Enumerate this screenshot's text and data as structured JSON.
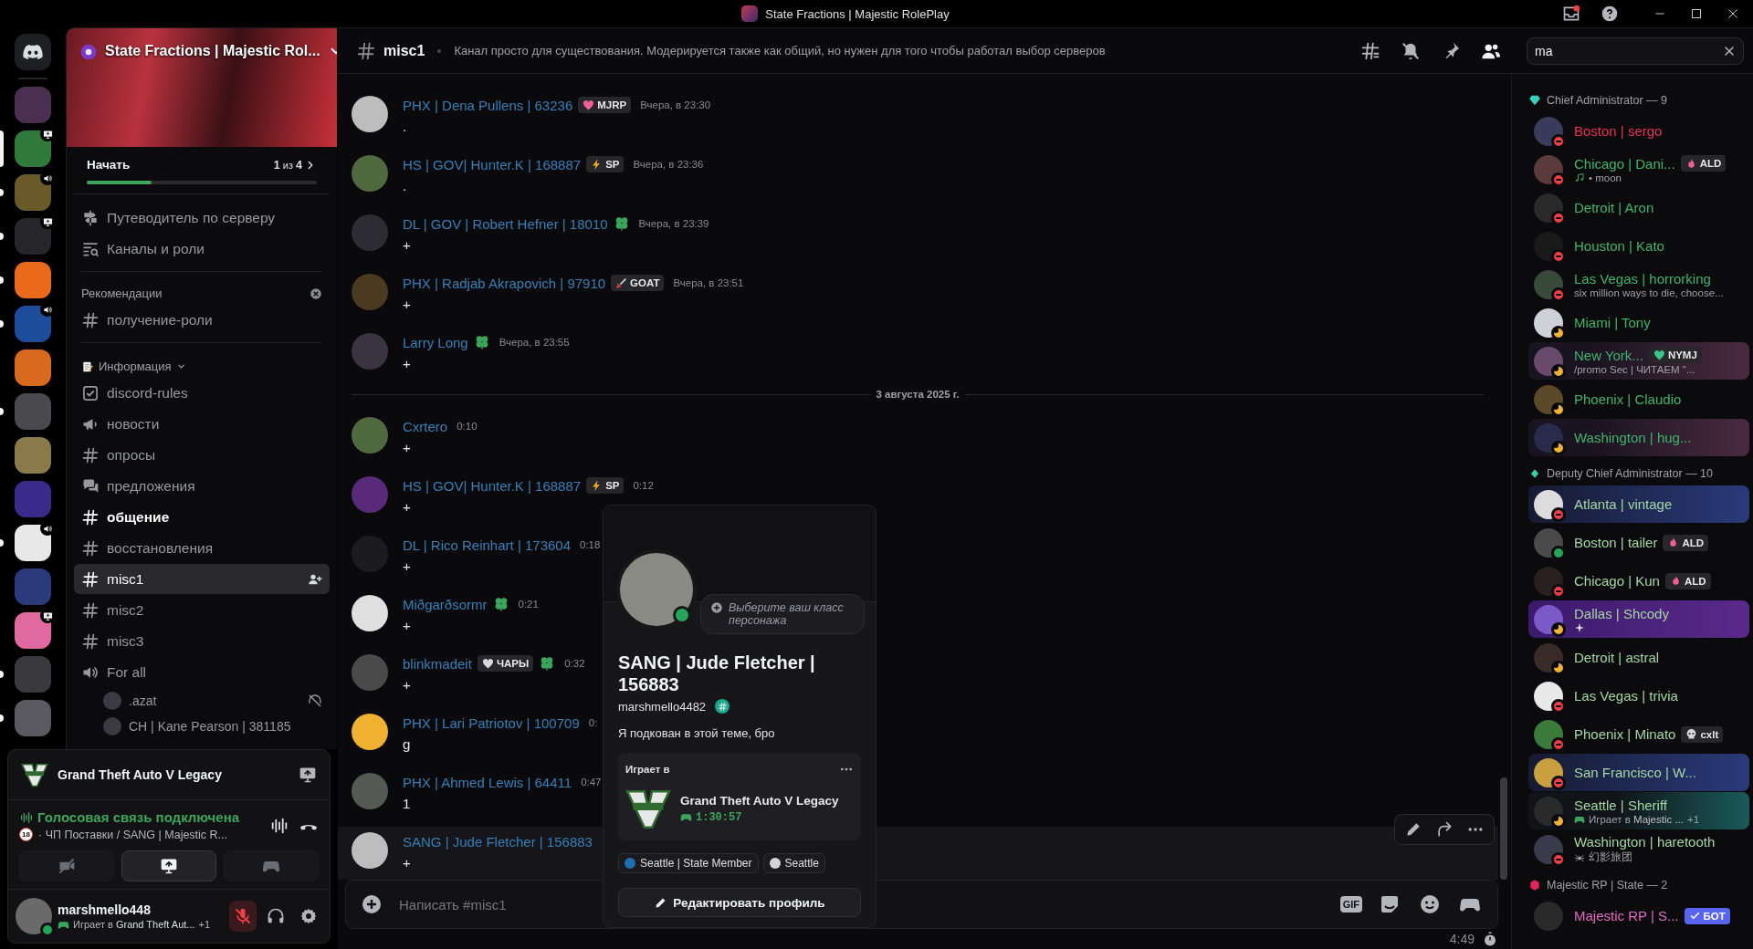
{
  "title_bar": {
    "title": "State Fractions | Majestic RolePlay"
  },
  "servers": [
    {
      "kind": "home",
      "selected": false,
      "unread": false,
      "voice": false,
      "streaming": false
    },
    {
      "kind": "server",
      "selected": false,
      "unread": false,
      "voice": false,
      "streaming": false
    },
    {
      "kind": "server",
      "selected": true,
      "unread": false,
      "voice": false,
      "streaming": true
    },
    {
      "kind": "server",
      "selected": false,
      "unread": true,
      "voice": true,
      "streaming": false
    },
    {
      "kind": "server",
      "selected": false,
      "unread": true,
      "voice": false,
      "streaming": true
    },
    {
      "kind": "server",
      "selected": false,
      "unread": true,
      "voice": false,
      "streaming": false
    },
    {
      "kind": "server",
      "selected": false,
      "unread": true,
      "voice": true,
      "streaming": false
    },
    {
      "kind": "server",
      "selected": false,
      "unread": false,
      "voice": false,
      "streaming": false
    },
    {
      "kind": "server",
      "selected": false,
      "unread": true,
      "voice": false,
      "streaming": false
    },
    {
      "kind": "server",
      "selected": false,
      "unread": false,
      "voice": false,
      "streaming": false
    },
    {
      "kind": "server",
      "selected": false,
      "unread": false,
      "voice": false,
      "streaming": false
    },
    {
      "kind": "server",
      "selected": false,
      "unread": true,
      "voice": true,
      "streaming": false
    },
    {
      "kind": "server",
      "selected": false,
      "unread": false,
      "voice": false,
      "streaming": false
    },
    {
      "kind": "server",
      "selected": false,
      "unread": false,
      "voice": false,
      "streaming": true
    },
    {
      "kind": "server",
      "selected": false,
      "unread": true,
      "voice": false,
      "streaming": false
    },
    {
      "kind": "server",
      "selected": false,
      "unread": true,
      "voice": false,
      "streaming": false
    }
  ],
  "channel_sidebar": {
    "server_name": "State Fractions | Majestic Rol...",
    "onboarding": {
      "label": "Начать",
      "progress": "**1** из **4**",
      "level": 0.28
    },
    "nav": [
      {
        "kind": "guide",
        "label": "Путеводитель по серверу"
      },
      {
        "kind": "browse",
        "label": "Каналы и роли"
      }
    ],
    "recommendations": {
      "title": "Рекомендации",
      "channels": [
        {
          "kind": "text",
          "name": "получение-роли"
        }
      ]
    },
    "category": {
      "name": "Информация",
      "expanded": true
    },
    "channels": [
      {
        "kind": "rules",
        "name": "discord-rules",
        "unread": false,
        "selected": false
      },
      {
        "kind": "announcement",
        "name": "новости",
        "unread": false,
        "selected": false
      },
      {
        "kind": "text",
        "name": "опросы",
        "unread": false,
        "selected": false
      },
      {
        "kind": "forum",
        "name": "предложения",
        "unread": false,
        "selected": false
      },
      {
        "kind": "text",
        "name": "общение",
        "unread": true,
        "selected": false
      },
      {
        "kind": "text",
        "name": "восстановления",
        "unread": false,
        "selected": false
      },
      {
        "kind": "text",
        "name": "misc1",
        "unread": false,
        "selected": true
      },
      {
        "kind": "text",
        "name": "misc2",
        "unread": false,
        "selected": false
      },
      {
        "kind": "text",
        "name": "misc3",
        "unread": false,
        "selected": false
      },
      {
        "kind": "voice",
        "name": "For all",
        "unread": false,
        "selected": false
      }
    ],
    "voice_users": [
      {
        "name": ".azat",
        "muted": true
      },
      {
        "name": "CH | Kane Pearson | 381185",
        "muted": false
      }
    ]
  },
  "activity_panel": {
    "game": "Grand Theft Auto V Legacy"
  },
  "voice_panel": {
    "status": "Голосовая связь подключена",
    "age_badge": "18",
    "location": "· ЧП Поставки / SANG | Majestic R...",
    "buttons": [
      {
        "kind": "camera",
        "selected": false
      },
      {
        "kind": "screen",
        "selected": true
      },
      {
        "kind": "activity",
        "selected": false
      }
    ]
  },
  "user_panel": {
    "username": "marshmello448",
    "activity": "Играет в **Grand Theft Aut...**",
    "extra": "+1",
    "status": {
      "kind": "online",
      "color": "#23a55a"
    },
    "mic_muted": true
  },
  "chat": {
    "channel": "misc1",
    "topic": "Канал просто для существования. Модерируется также как общий, но нужен для того чтобы работал выбор серверов",
    "header_buttons": [
      {
        "kind": "threads",
        "selected": false
      },
      {
        "kind": "notifications",
        "selected": false
      },
      {
        "kind": "pins",
        "selected": false
      },
      {
        "kind": "members",
        "selected": true
      }
    ],
    "search": {
      "value": "ma"
    },
    "messages": [
      {
        "kind": "message",
        "author": "PHX | Dena Pullens | 63236",
        "badge": {
          "kind": "heart",
          "text": "MJRP"
        },
        "clover": false,
        "time": "Вчера, в 23:30",
        "text": ".",
        "highlighted": false
      },
      {
        "kind": "message",
        "author": "HS | GOV| Hunter.K | 168887",
        "badge": {
          "kind": "bolt",
          "text": "SP"
        },
        "clover": false,
        "time": "Вчера, в 23:36",
        "text": ".",
        "highlighted": false
      },
      {
        "kind": "message",
        "author": "DL | GOV | Robert Hefner | 18010",
        "clover": true,
        "time": "Вчера, в 23:39",
        "text": "+",
        "highlighted": false
      },
      {
        "kind": "message",
        "author": "PHX | Radjab Akrapovich | 97910",
        "badge": {
          "kind": "sword",
          "text": "GOAT"
        },
        "clover": false,
        "time": "Вчера, в 23:51",
        "text": "+",
        "highlighted": false
      },
      {
        "kind": "message",
        "author": "Larry Long",
        "clover": true,
        "time": "Вчера, в 23:55",
        "text": "+",
        "highlighted": false
      },
      {
        "kind": "divider",
        "text": "3 августа 2025 г."
      },
      {
        "kind": "message",
        "author": "Cxrtero",
        "clover": false,
        "time": "0:10",
        "text": "+",
        "highlighted": false
      },
      {
        "kind": "message",
        "author": "HS | GOV| Hunter.K | 168887",
        "badge": {
          "kind": "bolt",
          "text": "SP"
        },
        "clover": false,
        "time": "0:12",
        "text": "+",
        "highlighted": false
      },
      {
        "kind": "message",
        "author": "DL | Rico Reinhart | 173604",
        "clover": false,
        "time": "0:18",
        "text": "+",
        "highlighted": false
      },
      {
        "kind": "message",
        "author": "Miðgarðsormr",
        "clover": true,
        "time": "0:21",
        "text": "+",
        "highlighted": false
      },
      {
        "kind": "message",
        "author": "blinkmadeit",
        "badge": {
          "kind": "grey-heart",
          "text": "ЧАРЫ"
        },
        "clover": true,
        "time": "0:32",
        "text": "+",
        "highlighted": false
      },
      {
        "kind": "message",
        "author": "PHX | Lari Patriotov | 100709",
        "clover": false,
        "time": "0:",
        "text": "g",
        "highlighted": false
      },
      {
        "kind": "message",
        "author": "PHX | Ahmed Lewis | 64411",
        "clover": false,
        "time": "0:47",
        "text": "1",
        "highlighted": false
      },
      {
        "kind": "message",
        "author": "SANG | Jude Fletcher | 156883",
        "clover": false,
        "text": "+",
        "highlighted": true
      }
    ],
    "composer": {
      "placeholder": "Написать #misc1",
      "gif": "GIF"
    },
    "slowmode": "4:49"
  },
  "profile_popup": {
    "class_prompt": "Выберите ваш класс персонажа",
    "display_name": "SANG | Jude Fletcher | 156883",
    "username": "marshmello4482",
    "bio": "Я подкован в этой теме, бро",
    "status": {
      "kind": "online",
      "color": "#23a55a"
    },
    "activity": {
      "heading": "Играет в",
      "game": "Grand Theft Auto V Legacy",
      "elapsed": "1:30:57"
    },
    "roles": [
      {
        "name": "Seattle | State Member",
        "color": "#1f6fb0"
      },
      {
        "name": "Seattle",
        "color": "#d4d4d8"
      }
    ],
    "edit_button": "Редактировать профиль"
  },
  "members": {
    "groups": [
      {
        "title": "Chief Administrator — 9",
        "kind": "gem",
        "color": "#35d0c0",
        "members": [
          {
            "name": "Boston | sergo",
            "color": "#e8325c",
            "status": {
              "kind": "dnd",
              "color": "#f23f43"
            },
            "kind": "plain"
          },
          {
            "name": "Chicago | Dani...",
            "color": "#3fb46e",
            "status": {
              "kind": "dnd",
              "color": "#f23f43"
            },
            "kind": "plain",
            "badge": {
              "kind": "flame",
              "text": "ALD"
            },
            "sub": {
              "kind": "listening",
              "text": "• moon"
            }
          },
          {
            "name": "Detroit | Aron",
            "color": "#3fb46e",
            "status": {
              "kind": "dnd",
              "color": "#f23f43"
            },
            "kind": "plain"
          },
          {
            "name": "Houston | Kato",
            "color": "#3fb46e",
            "status": {
              "kind": "dnd",
              "color": "#f23f43"
            },
            "kind": "plain"
          },
          {
            "name": "Las Vegas | horrorking",
            "color": "#3fb46e",
            "status": {
              "kind": "dnd",
              "color": "#f23f43"
            },
            "kind": "plain",
            "sub": {
              "kind": "custom",
              "text": "six million ways to die, choose..."
            }
          },
          {
            "name": "Miami | Tony",
            "color": "#3fb46e",
            "status": {
              "kind": "idle",
              "color": "#f0b232"
            },
            "kind": "plain"
          },
          {
            "name": "New York...",
            "color": "#3fb46e",
            "status": {
              "kind": "idle",
              "color": "#f0b232"
            },
            "kind": "flowers",
            "badge": {
              "kind": "green-heart",
              "text": "NYMJ"
            },
            "sub": {
              "kind": "custom",
              "text": "/promo Sec | ЧИТАЕМ \"..."
            }
          },
          {
            "name": "Phoenix | Claudio",
            "color": "#3fb46e",
            "status": {
              "kind": "idle",
              "color": "#f0b232"
            },
            "kind": "plain"
          },
          {
            "name": "Washington | hug...",
            "color": "#3fb46e",
            "status": {
              "kind": "idle",
              "color": "#f0b232"
            },
            "kind": "flowers"
          }
        ]
      },
      {
        "title": "Deputy Chief Administrator — 10",
        "kind": "small-gem",
        "color": "#35d0a8",
        "members": [
          {
            "name": "Atlanta | vintage",
            "color": "#a4d6a6",
            "status": {
              "kind": "dnd",
              "color": "#f23f43"
            },
            "kind": "space"
          },
          {
            "name": "Boston | tailer",
            "color": "#a4d6a6",
            "status": {
              "kind": "online",
              "color": "#23a55a"
            },
            "kind": "plain",
            "badge": {
              "kind": "flame",
              "text": "ALD"
            }
          },
          {
            "name": "Chicago | Kun",
            "color": "#a4d6a6",
            "status": {
              "kind": "dnd",
              "color": "#f23f43"
            },
            "kind": "plain",
            "badge": {
              "kind": "flame",
              "text": "ALD"
            }
          },
          {
            "name": "Dallas | Shcody",
            "color": "#a4d6a6",
            "status": {
              "kind": "idle",
              "color": "#f0b232"
            },
            "kind": "city",
            "sub": {
              "kind": "sparkle"
            }
          },
          {
            "name": "Detroit | astral",
            "color": "#a4d6a6",
            "status": {
              "kind": "idle",
              "color": "#f0b232"
            },
            "kind": "plain"
          },
          {
            "name": "Las Vegas | trivia",
            "color": "#a4d6a6",
            "status": {
              "kind": "dnd",
              "color": "#f23f43"
            },
            "kind": "plain"
          },
          {
            "name": "Phoenix | Minato",
            "color": "#a4d6a6",
            "status": {
              "kind": "dnd",
              "color": "#f23f43"
            },
            "kind": "plain",
            "badge": {
              "kind": "skull",
              "text": "cxlt"
            }
          },
          {
            "name": "San Francisco | W...",
            "color": "#a4d6a6",
            "status": {
              "kind": "dnd",
              "color": "#f23f43"
            },
            "kind": "space"
          },
          {
            "name": "Seattle | Sheriff",
            "color": "#a4d6a6",
            "status": {
              "kind": "idle",
              "color": "#f0b232"
            },
            "kind": "ocean",
            "sub": {
              "kind": "playing",
              "text": "Играет в **Majestic ...**",
              "extra": "+1"
            }
          },
          {
            "name": "Washington | haretooth",
            "color": "#a4d6a6",
            "status": {
              "kind": "dnd",
              "color": "#f23f43"
            },
            "kind": "plain",
            "sub": {
              "kind": "spider",
              "text": "幻影旅团"
            }
          }
        ]
      },
      {
        "title": "Majestic RP | State — 2",
        "kind": "hexagon",
        "color": "#e0245e",
        "members": [
          {
            "name": "Majestic RP | S...",
            "color": "#e46bc6",
            "kind": "plain",
            "badge": {
              "kind": "check",
              "text": "БОТ"
            }
          }
        ]
      }
    ]
  }
}
